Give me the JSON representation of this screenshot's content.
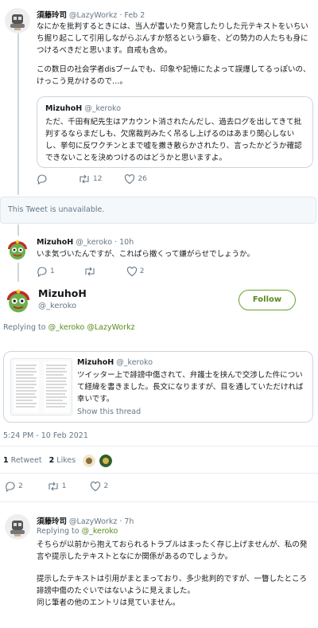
{
  "tweet1": {
    "name": "須藤玲司",
    "handle": "@LazyWorkz",
    "date": "· Feb 2",
    "text1": "なにかを批判するときには、当人が書いたり発言したりした元テキストをいちいち掘り起こして引用しながらぶんすか怒るという癖を、どの勢力の人たちも身につけるべきだと思います。自戒も含め。",
    "text2": "この数日の社会学者disブームでも、印象や記憶にたよって誤爆してるっぽいの、けっこう見かけるので…。",
    "quote": {
      "name": "MizuhoH",
      "handle": "@_keroko",
      "text": "ただ、千田有紀先生はアカウント消されたんだし、過去ログを出してきて批判するならまだしも、欠席裁判みたく吊るし上げるのはあまり関心しないし、挙句に反ワクチンとまで嘘を撒き散らかされたり、言ったかどうか確認できないことを決めつけるのはどうかと思いますよ。"
    },
    "retweets": "12",
    "likes": "26"
  },
  "unavailable": "This Tweet is unavailable.",
  "tweet2": {
    "name": "MizuhoH",
    "handle": "@_keroko",
    "date": "· 10h",
    "text": "いま気づいたんですが、これぱら撤くって嫌がらせでしょうか。",
    "replies": "1",
    "likes": "2"
  },
  "main": {
    "name": "MizuhoH",
    "handle": "@_keroko",
    "follow_label": "Follow",
    "replying_prefix": "Replying to ",
    "replying_to": "@_keroko @LazyWorkz",
    "card": {
      "name": "MizuhoH",
      "handle": "@_keroko",
      "text": "ツイッター上で誹謗中傷されて、弁護士を挟んで交渉した件について経緯を書きました。長文になりますが、目を通していただければ幸いです。",
      "show_thread": "Show this thread"
    },
    "timestamp": "5:24 PM - 10 Feb 2021",
    "retweet_count": "1",
    "retweet_label": "Retweet",
    "likes_count": "2",
    "likes_label": "Likes",
    "replies": "2",
    "retweets": "1",
    "likes": "2"
  },
  "tweet3": {
    "name": "須藤玲司",
    "handle": "@LazyWorkz",
    "date": "· 7h",
    "replying_prefix": "Replying to ",
    "replying_to": "@_keroko",
    "text1": "そちらが以前から抱えておられるトラブルはまったく存じ上げませんが、私の発言や提示したテキストとなにか関係があるのでしょうか。",
    "text2": "提示したテキストは引用がまとまっており、多少批判的ですが、一瞥したところ誹謗中傷のたぐいではないように見えました。",
    "text3": "同じ筆者の他のエントリは見ていません。"
  },
  "colors": {
    "link": "#5a8a1e",
    "follow_border": "#6aa12a",
    "muted": "#657786",
    "line": "#ccd6dd"
  }
}
